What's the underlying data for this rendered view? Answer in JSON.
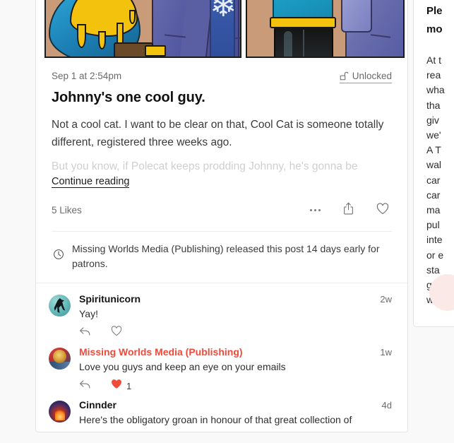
{
  "post": {
    "date": "Sep 1 at 2:54pm",
    "unlocked_label": "Unlocked",
    "unlocked_icon": "unlock-icon",
    "title": "Johnny's one cool guy.",
    "paragraph_1": "Not a cool cat. I want to be clear on that, Cool Cat is someone totally different, registered three weeks ago.",
    "paragraph_2_faded": "But you know, if Polecat keeps prodding Johnny, he's gonna be",
    "continue_label": "Continue reading",
    "likes": "5 Likes",
    "icons": {
      "more": "ellipsis-icon",
      "share": "share-icon",
      "like": "heart-outline-icon"
    },
    "early_access_note": "Missing Worlds Media (Publishing) released this post 14 days early for patrons.",
    "early_access_icon": "clock-icon",
    "image_alt_1": "comic-panel-left",
    "image_alt_2": "comic-panel-right"
  },
  "comments": [
    {
      "name": "Spiritunicorn",
      "time": "2w",
      "text": "Yay!",
      "is_creator": false,
      "avatar": "avatar-spiritunicorn",
      "like_count": "",
      "liked": false
    },
    {
      "name": "Missing Worlds Media (Publishing)",
      "time": "1w",
      "text": "Love you guys and keep an eye on your emails",
      "is_creator": true,
      "avatar": "avatar-missing-worlds-media",
      "like_count": "1",
      "liked": true
    },
    {
      "name": "Cinnder",
      "time": "4d",
      "text": "Here's the obligatory groan in honour of that great collection of",
      "is_creator": false,
      "avatar": "avatar-cinnder",
      "like_count": "",
      "liked": false
    }
  ],
  "right_panel": {
    "title_line_1": "Ple",
    "title_line_2": "mo",
    "body_lines": [
      "At t",
      "rea",
      "wha",
      "tha",
      "giv",
      "we'",
      "A T",
      "wal",
      "car",
      "car",
      "ma",
      "pul",
      "inte",
      "or e",
      "sta",
      "get",
      "wha"
    ]
  },
  "colors": {
    "creator_red": "#ef4a3c",
    "heart_red": "#ef4a3c",
    "page_bg": "#f9f9f9",
    "card_bg": "#ffffff",
    "border": "#e4e4e4",
    "muted_text": "#6b6b6b",
    "faded_text": "#cfcfcf"
  }
}
